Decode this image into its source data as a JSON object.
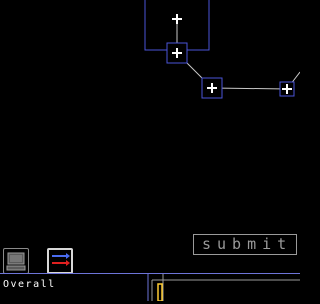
{
  "submit": {
    "label": "submit"
  },
  "toolbar": {
    "tools": [
      {
        "icon": "computer-icon",
        "active": false
      },
      {
        "icon": "arrows-icon",
        "active": true
      }
    ]
  },
  "status": {
    "label": "Overall"
  },
  "colors": {
    "background": "#000000",
    "node_border": "#4a55d8",
    "link": "#c8c8c8",
    "marker": "#ffffff",
    "button_text": "#9a9a9a",
    "arrow_blue": "#4a6cf0",
    "arrow_red": "#e02020",
    "highlight": "#ffcc33"
  }
}
